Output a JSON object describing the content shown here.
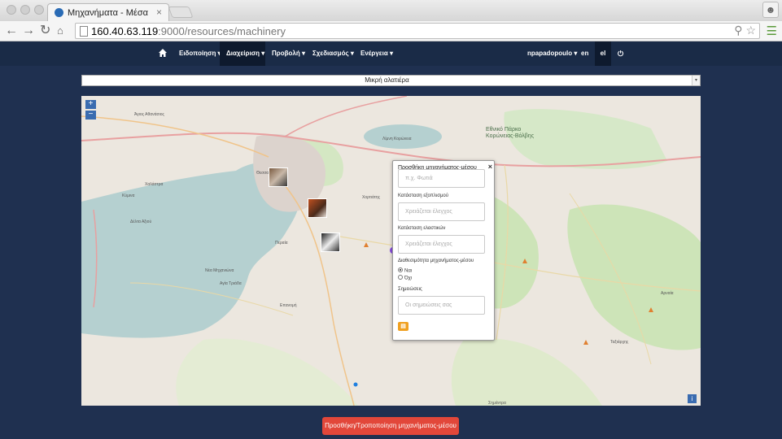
{
  "browser": {
    "tab_title": "Μηχανήματα - Μέσα",
    "tab_close": "×",
    "url_host": "160.40.63.119",
    "url_rest": ":9000/resources/machinery",
    "profile_icon": "person-icon"
  },
  "nav": {
    "items": [
      {
        "label": "Ειδοποίηση ▾"
      },
      {
        "label": "Διαχείριση ▾"
      },
      {
        "label": "Προβολή ▾"
      },
      {
        "label": "Σχεδιασμός ▾"
      },
      {
        "label": "Ενέργεια ▾"
      }
    ],
    "user": "npapadopoulo ▾",
    "lang_en": "en",
    "lang_el": "el",
    "power_icon": "power-icon"
  },
  "select": {
    "value": "Μικρή αλατιέρα",
    "arrow": "▾"
  },
  "map": {
    "zoom_in": "+",
    "zoom_out": "−",
    "info": "i",
    "labels": [
      {
        "text": "Εθνικό Πάρκο Κορώνειας-Βόλβης"
      },
      {
        "text": "Λίμνη Κορώνεια"
      },
      {
        "text": "Θεσσαλονίκη"
      },
      {
        "text": "Χαλάστρα"
      },
      {
        "text": "Κύμινα"
      },
      {
        "text": "Δέλτα Αξιού"
      },
      {
        "text": "Άγιος Αθανάσιος"
      },
      {
        "text": "Νέα Μηχανιώνα"
      },
      {
        "text": "Επανομή"
      },
      {
        "text": "Αγία Τριάδα"
      },
      {
        "text": "Περαία"
      },
      {
        "text": "Χορτιάτης"
      },
      {
        "text": "Σημάντρα"
      },
      {
        "text": "Αρναία"
      },
      {
        "text": "Ταξιάρχης"
      }
    ]
  },
  "popup": {
    "title": "Προσθήκη μηχανήματος-μέσου",
    "close": "×",
    "name_placeholder": "π.χ. Φωτιά",
    "equipment_label": "Κατάσταση εξοπλισμού",
    "equipment_placeholder": "Χρειάζεται έλεγχος",
    "tires_label": "Κατάσταση ελαστικών",
    "tires_placeholder": "Χρειάζεται έλεγχος",
    "availability_label": "Διαθεσιμότητα μηχανήματος-μέσου",
    "availability_options": [
      {
        "label": "Ναι",
        "checked": true
      },
      {
        "label": "Όχι",
        "checked": false
      }
    ],
    "notes_label": "Σημειώσεις",
    "notes_placeholder": "Οι σημειώσεις σας",
    "save_icon": "save-icon"
  },
  "action_button": "Προσθήκη/Τροποποίηση μηχανήματος-μέσου"
}
